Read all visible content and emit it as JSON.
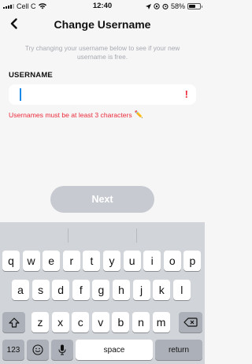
{
  "status_bar": {
    "carrier": "Cell C",
    "time": "12:40",
    "battery_percent": "58%",
    "battery_level": 0.58
  },
  "header": {
    "title": "Change Username",
    "back_icon": "chevron-left-icon"
  },
  "subtitle": "Try changing your username below to see if your new username is free.",
  "form": {
    "label": "USERNAME",
    "value": "",
    "error_icon": "!",
    "error_message": "Usernames must be at least 3 characters",
    "error_emoji": "✏️"
  },
  "next_button": {
    "label": "Next"
  },
  "keyboard": {
    "row1": [
      "q",
      "w",
      "e",
      "r",
      "t",
      "y",
      "u",
      "i",
      "o",
      "p"
    ],
    "row2": [
      "a",
      "s",
      "d",
      "f",
      "g",
      "h",
      "j",
      "k",
      "l"
    ],
    "row3": [
      "z",
      "x",
      "c",
      "v",
      "b",
      "n",
      "m"
    ],
    "numbers_key": "123",
    "space_key": "space",
    "return_key": "return",
    "shift_icon": "shift-icon",
    "delete_icon": "backspace-icon",
    "emoji_icon": "emoji-icon",
    "mic_icon": "microphone-icon"
  },
  "colors": {
    "error": "#ec2a3a",
    "caret": "#1b8ae6",
    "disabled_button": "#c7cbd1"
  }
}
